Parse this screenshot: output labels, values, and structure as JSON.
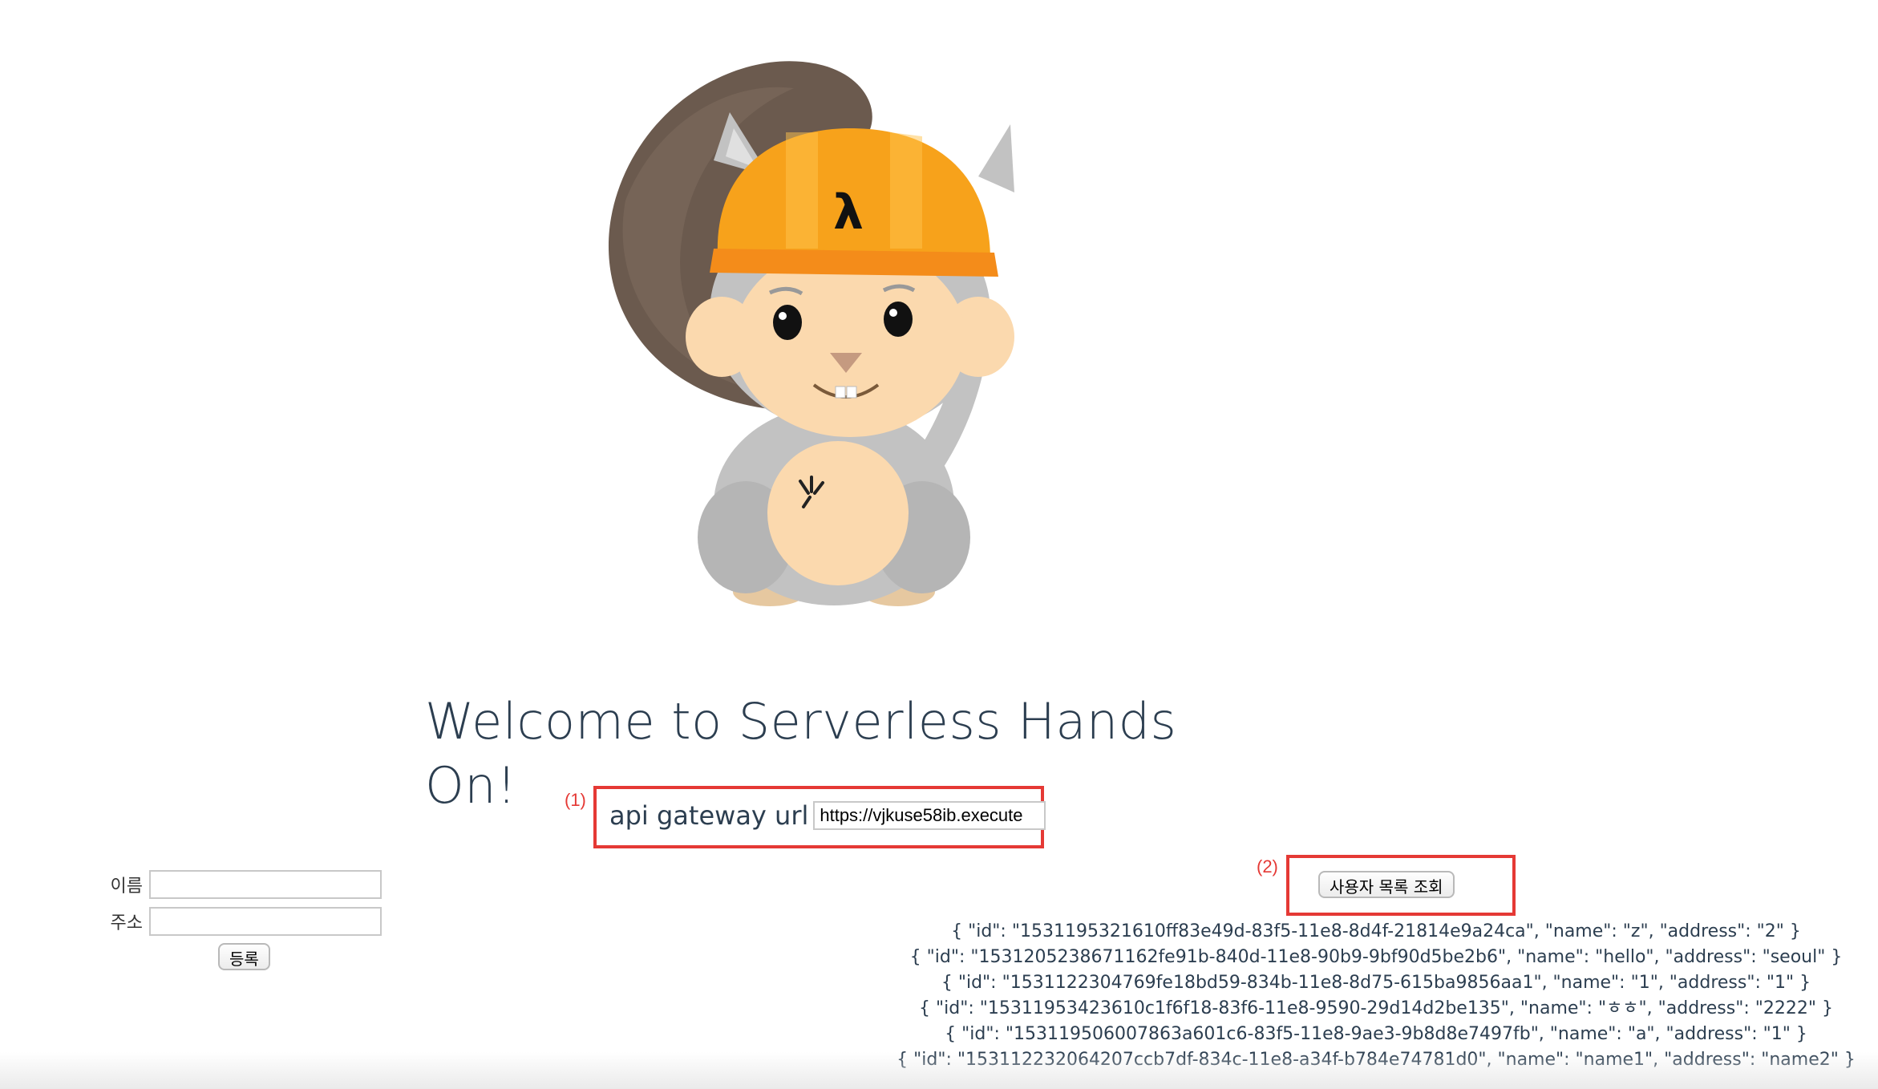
{
  "page": {
    "welcome_title": "Welcome to Serverless Hands On!"
  },
  "annotations": {
    "step1": "(1)",
    "step2": "(2)"
  },
  "api_gateway": {
    "label": "api gateway url",
    "value": "https://vjkuse58ib.execute"
  },
  "register_form": {
    "name_label": "이름",
    "name_value": "",
    "address_label": "주소",
    "address_value": "",
    "submit_label": "등록"
  },
  "user_list": {
    "button_label": "사용자 목록 조회",
    "records": [
      "{ \"id\": \"1531195321610ff83e49d-83f5-11e8-8d4f-21814e9a24ca\", \"name\": \"z\", \"address\": \"2\" }",
      "{ \"id\": \"1531205238671162fe91b-840d-11e8-90b9-9bf90d5be2b6\", \"name\": \"hello\", \"address\": \"seoul\" }",
      "{ \"id\": \"1531122304769fe18bd59-834b-11e8-8d75-615ba9856aa1\", \"name\": \"1\", \"address\": \"1\" }",
      "{ \"id\": \"15311953423610c1f6f18-83f6-11e8-9590-29d14d2be135\", \"name\": \"ㅎㅎ\", \"address\": \"2222\" }",
      "{ \"id\": \"153119506007863a601c6-83f5-11e8-9ae3-9b8d8e7497fb\", \"name\": \"a\", \"address\": \"1\" }",
      "{ \"id\": \"153112232064207ccb7df-834c-11e8-a34f-b784e74781d0\", \"name\": \"name1\", \"address\": \"name2\" }"
    ]
  },
  "colors": {
    "text": "#2c3e50",
    "annotation_red": "#e53935",
    "helmet_orange": "#f7a21b",
    "tail_brown": "#6b5a4e",
    "fur_gray": "#c2c2c2",
    "face_peach": "#fbd9ae"
  },
  "icons": {
    "logo": "serverless-squirrel-mascot",
    "helmet_symbol": "lambda-icon"
  }
}
